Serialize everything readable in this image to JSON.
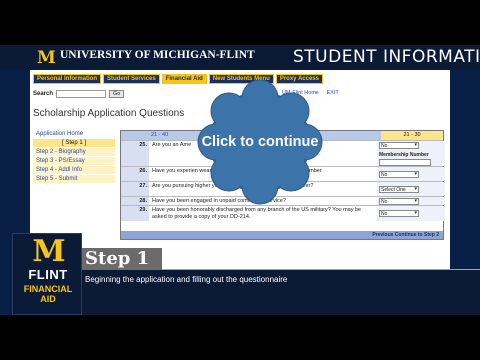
{
  "header": {
    "logo_m": "M",
    "university": "UNIVERSITY OF MICHIGAN-FLINT",
    "section": "STUDENT INFORMATI"
  },
  "nav": {
    "tabs": [
      {
        "label": "Personal Information",
        "active": false
      },
      {
        "label": "Student Services",
        "active": false
      },
      {
        "label": "Financial Aid",
        "active": true
      },
      {
        "label": "New Students Menu",
        "active": false
      },
      {
        "label": "Proxy Access",
        "active": false
      }
    ]
  },
  "search": {
    "label": "Search",
    "go": "Go"
  },
  "links": {
    "home": "UM-Flint Home",
    "exit": "EXIT"
  },
  "page": {
    "title": "Scholarship Application Questions"
  },
  "sidebar": {
    "items": [
      {
        "label": "Application Home",
        "state": "link"
      },
      {
        "label": "[ Step 1 ]",
        "state": "current"
      },
      {
        "label": "Step 2 - Biography",
        "state": "link"
      },
      {
        "label": "Step 3 - PS/Essay",
        "state": "link"
      },
      {
        "label": "Step 4 - Addl Info",
        "state": "link"
      },
      {
        "label": "Step 5 - Submit",
        "state": "link"
      }
    ]
  },
  "questions": {
    "range_left": "21 - 40",
    "range_right": "21 - 30",
    "rows": [
      {
        "num": "25.",
        "text": "Are you an Ame",
        "answer": "No",
        "extra_label": "Membership Number"
      },
      {
        "num": "26.",
        "text": "Have you experien                       wearily impacts your finances? i.e., death                                   member",
        "answer": "No"
      },
      {
        "num": "27.",
        "text": "Are you pursuing higher                         you more marketable in a second career?",
        "answer": "Select One"
      },
      {
        "num": "28.",
        "text": "Have you been engaged in unpaid              community service?",
        "answer": "No"
      },
      {
        "num": "29.",
        "text": "Have you been honorably discharged from any branch of the US military? You may be asked to provide a copy of your DD-214.",
        "answer": "No"
      }
    ],
    "footer": "Previous   Continue to Step 2"
  },
  "overlay": {
    "click_label": "Click to continue"
  },
  "caption": {
    "step": "Step 1",
    "text": "Beginning the application and filling out the questionnaire"
  },
  "flint_logo": {
    "m": "M",
    "flint": "FLINT",
    "aid1": "FINANCIAL",
    "aid2": "AID"
  }
}
